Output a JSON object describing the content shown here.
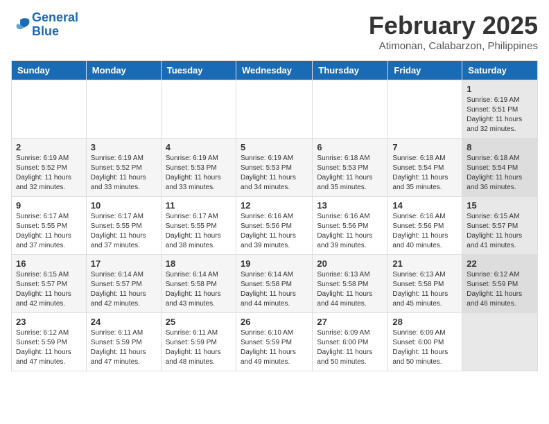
{
  "header": {
    "logo_line1": "General",
    "logo_line2": "Blue",
    "title": "February 2025",
    "location": "Atimonan, Calabarzon, Philippines"
  },
  "days_of_week": [
    "Sunday",
    "Monday",
    "Tuesday",
    "Wednesday",
    "Thursday",
    "Friday",
    "Saturday"
  ],
  "weeks": [
    [
      {
        "day": "",
        "info": ""
      },
      {
        "day": "",
        "info": ""
      },
      {
        "day": "",
        "info": ""
      },
      {
        "day": "",
        "info": ""
      },
      {
        "day": "",
        "info": ""
      },
      {
        "day": "",
        "info": ""
      },
      {
        "day": "1",
        "info": "Sunrise: 6:19 AM\nSunset: 5:51 PM\nDaylight: 11 hours and 32 minutes."
      }
    ],
    [
      {
        "day": "2",
        "info": "Sunrise: 6:19 AM\nSunset: 5:52 PM\nDaylight: 11 hours and 32 minutes."
      },
      {
        "day": "3",
        "info": "Sunrise: 6:19 AM\nSunset: 5:52 PM\nDaylight: 11 hours and 33 minutes."
      },
      {
        "day": "4",
        "info": "Sunrise: 6:19 AM\nSunset: 5:53 PM\nDaylight: 11 hours and 33 minutes."
      },
      {
        "day": "5",
        "info": "Sunrise: 6:19 AM\nSunset: 5:53 PM\nDaylight: 11 hours and 34 minutes."
      },
      {
        "day": "6",
        "info": "Sunrise: 6:18 AM\nSunset: 5:53 PM\nDaylight: 11 hours and 35 minutes."
      },
      {
        "day": "7",
        "info": "Sunrise: 6:18 AM\nSunset: 5:54 PM\nDaylight: 11 hours and 35 minutes."
      },
      {
        "day": "8",
        "info": "Sunrise: 6:18 AM\nSunset: 5:54 PM\nDaylight: 11 hours and 36 minutes."
      }
    ],
    [
      {
        "day": "9",
        "info": "Sunrise: 6:17 AM\nSunset: 5:55 PM\nDaylight: 11 hours and 37 minutes."
      },
      {
        "day": "10",
        "info": "Sunrise: 6:17 AM\nSunset: 5:55 PM\nDaylight: 11 hours and 37 minutes."
      },
      {
        "day": "11",
        "info": "Sunrise: 6:17 AM\nSunset: 5:55 PM\nDaylight: 11 hours and 38 minutes."
      },
      {
        "day": "12",
        "info": "Sunrise: 6:16 AM\nSunset: 5:56 PM\nDaylight: 11 hours and 39 minutes."
      },
      {
        "day": "13",
        "info": "Sunrise: 6:16 AM\nSunset: 5:56 PM\nDaylight: 11 hours and 39 minutes."
      },
      {
        "day": "14",
        "info": "Sunrise: 6:16 AM\nSunset: 5:56 PM\nDaylight: 11 hours and 40 minutes."
      },
      {
        "day": "15",
        "info": "Sunrise: 6:15 AM\nSunset: 5:57 PM\nDaylight: 11 hours and 41 minutes."
      }
    ],
    [
      {
        "day": "16",
        "info": "Sunrise: 6:15 AM\nSunset: 5:57 PM\nDaylight: 11 hours and 42 minutes."
      },
      {
        "day": "17",
        "info": "Sunrise: 6:14 AM\nSunset: 5:57 PM\nDaylight: 11 hours and 42 minutes."
      },
      {
        "day": "18",
        "info": "Sunrise: 6:14 AM\nSunset: 5:58 PM\nDaylight: 11 hours and 43 minutes."
      },
      {
        "day": "19",
        "info": "Sunrise: 6:14 AM\nSunset: 5:58 PM\nDaylight: 11 hours and 44 minutes."
      },
      {
        "day": "20",
        "info": "Sunrise: 6:13 AM\nSunset: 5:58 PM\nDaylight: 11 hours and 44 minutes."
      },
      {
        "day": "21",
        "info": "Sunrise: 6:13 AM\nSunset: 5:58 PM\nDaylight: 11 hours and 45 minutes."
      },
      {
        "day": "22",
        "info": "Sunrise: 6:12 AM\nSunset: 5:59 PM\nDaylight: 11 hours and 46 minutes."
      }
    ],
    [
      {
        "day": "23",
        "info": "Sunrise: 6:12 AM\nSunset: 5:59 PM\nDaylight: 11 hours and 47 minutes."
      },
      {
        "day": "24",
        "info": "Sunrise: 6:11 AM\nSunset: 5:59 PM\nDaylight: 11 hours and 47 minutes."
      },
      {
        "day": "25",
        "info": "Sunrise: 6:11 AM\nSunset: 5:59 PM\nDaylight: 11 hours and 48 minutes."
      },
      {
        "day": "26",
        "info": "Sunrise: 6:10 AM\nSunset: 5:59 PM\nDaylight: 11 hours and 49 minutes."
      },
      {
        "day": "27",
        "info": "Sunrise: 6:09 AM\nSunset: 6:00 PM\nDaylight: 11 hours and 50 minutes."
      },
      {
        "day": "28",
        "info": "Sunrise: 6:09 AM\nSunset: 6:00 PM\nDaylight: 11 hours and 50 minutes."
      },
      {
        "day": "",
        "info": ""
      }
    ]
  ]
}
